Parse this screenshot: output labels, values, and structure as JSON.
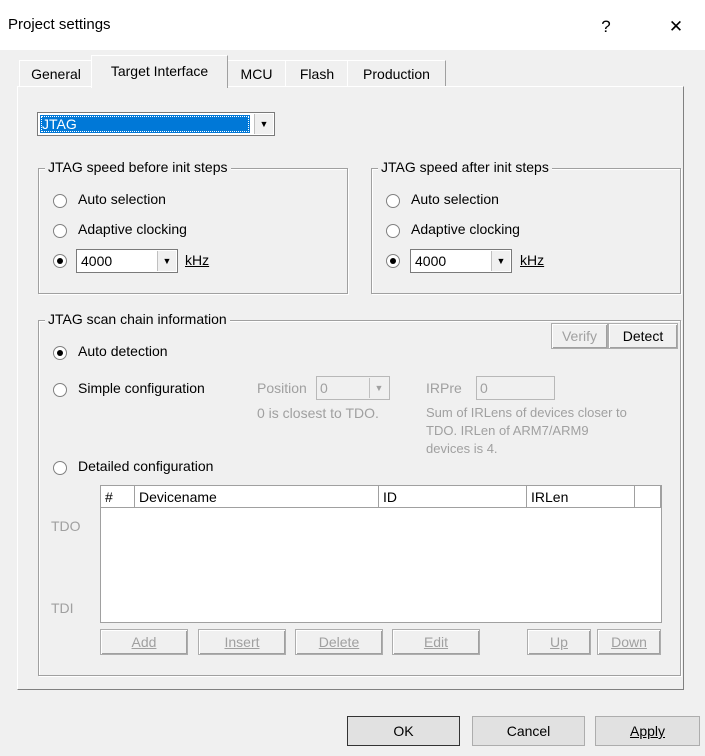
{
  "window": {
    "title": "Project settings",
    "help_glyph": "?",
    "close_glyph": "✕"
  },
  "tabs": [
    {
      "label": "General"
    },
    {
      "label": "Target Interface",
      "active": true
    },
    {
      "label": "MCU"
    },
    {
      "label": "Flash"
    },
    {
      "label": "Production"
    }
  ],
  "interface_select": {
    "value": "JTAG"
  },
  "speed_before": {
    "legend": "JTAG speed before init steps",
    "auto": "Auto selection",
    "adaptive": "Adaptive clocking",
    "speed_value": "4000",
    "unit": "kHz",
    "selected": "speed"
  },
  "speed_after": {
    "legend": "JTAG speed after init steps",
    "auto": "Auto selection",
    "adaptive": "Adaptive clocking",
    "speed_value": "4000",
    "unit": "kHz",
    "selected": "speed"
  },
  "scan_chain": {
    "legend": "JTAG scan chain information",
    "verify": "Verify",
    "detect": "Detect",
    "auto_detection": "Auto detection",
    "simple_config": "Simple configuration",
    "position_label": "Position",
    "position_value": "0",
    "position_hint": "0 is closest to TDO.",
    "irpre_label": "IRPre",
    "irpre_value": "0",
    "irpre_hint_1": "Sum of IRLens of devices closer to",
    "irpre_hint_2": "TDO. IRLen of ARM7/ARM9",
    "irpre_hint_3": "devices is 4.",
    "detailed_config": "Detailed configuration",
    "tdo": "TDO",
    "tdi": "TDI",
    "columns": [
      "#",
      "Devicename",
      "ID",
      "IRLen"
    ],
    "buttons": {
      "add": "Add",
      "insert": "Insert",
      "delete": "Delete",
      "edit": "Edit",
      "up": "Up",
      "down": "Down"
    }
  },
  "footer": {
    "ok": "OK",
    "cancel": "Cancel",
    "apply": "Apply"
  },
  "colors": {
    "selection": "#0078d7",
    "dialog_bg": "#f0f0f0"
  }
}
